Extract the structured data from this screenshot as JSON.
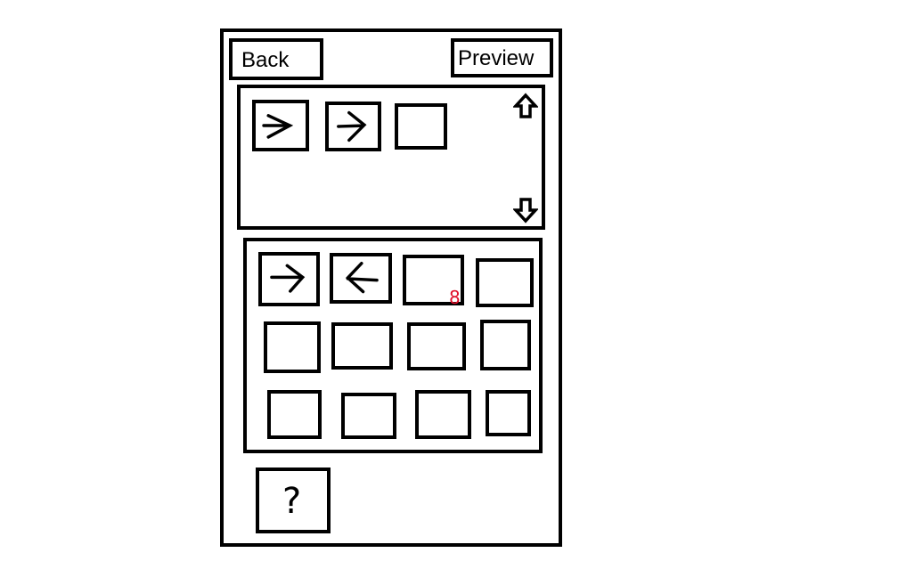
{
  "header": {
    "back_label": "Back",
    "preview_label": "Preview"
  },
  "sequence_panel": {
    "tiles": [
      {
        "icon": "arrow-right-icon"
      },
      {
        "icon": "arrow-right-icon"
      },
      {
        "icon": "empty"
      }
    ],
    "scroll_up_icon": "arrow-up-outline-icon",
    "scroll_down_icon": "arrow-down-outline-icon"
  },
  "palette_panel": {
    "rows": [
      [
        {
          "icon": "arrow-right-icon"
        },
        {
          "icon": "arrow-left-icon"
        },
        {
          "icon": "empty"
        },
        {
          "icon": "empty"
        }
      ],
      [
        {
          "icon": "empty"
        },
        {
          "icon": "empty"
        },
        {
          "icon": "empty"
        },
        {
          "icon": "empty"
        }
      ],
      [
        {
          "icon": "empty"
        },
        {
          "icon": "empty"
        },
        {
          "icon": "empty"
        },
        {
          "icon": "empty"
        }
      ]
    ],
    "annotation": "8",
    "annotation_color": "#e0102a"
  },
  "help": {
    "label": "?"
  }
}
